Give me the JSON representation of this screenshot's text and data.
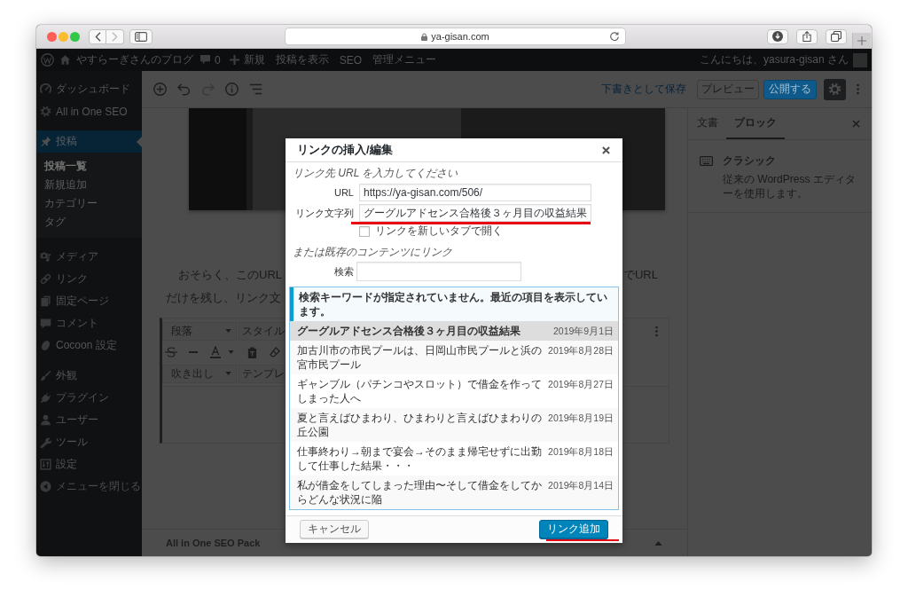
{
  "browser": {
    "back": {
      "disabled": false
    },
    "forward": {
      "disabled": true
    },
    "url": "ya-gisan.com"
  },
  "admin_bar": {
    "site_name": "やすらーぎさんのブログ",
    "comment_count": "0",
    "new_label": "新規",
    "links": [
      "投稿を表示",
      "SEO",
      "管理メニュー"
    ],
    "greeting": "こんにちは、yasura-gisan さん"
  },
  "sidebar": {
    "groups": [
      {
        "items": [
          {
            "label": "ダッシュボード",
            "selected": false
          },
          {
            "label": "All in One SEO",
            "selected": false
          }
        ]
      },
      {
        "items": [
          {
            "label": "投稿",
            "selected": true,
            "children": [
              {
                "label": "投稿一覧",
                "selected": true
              },
              {
                "label": "新規追加",
                "selected": false
              },
              {
                "label": "カテゴリー",
                "selected": false
              },
              {
                "label": "タグ",
                "selected": false
              }
            ]
          }
        ]
      },
      {
        "items": [
          {
            "label": "メディア",
            "selected": false
          },
          {
            "label": "リンク",
            "selected": false
          },
          {
            "label": "固定ページ",
            "selected": false
          },
          {
            "label": "コメント",
            "selected": false
          },
          {
            "label": "Cocoon 設定",
            "selected": false
          }
        ]
      },
      {
        "items": [
          {
            "label": "外観",
            "selected": false
          },
          {
            "label": "プラグイン",
            "selected": false
          },
          {
            "label": "ユーザー",
            "selected": false
          },
          {
            "label": "ツール",
            "selected": false
          },
          {
            "label": "設定",
            "selected": false
          }
        ]
      }
    ],
    "collapse_label": "メニューを閉じる"
  },
  "editor_header": {
    "tools": [
      {
        "disabled": false
      },
      {
        "disabled": false
      },
      {
        "disabled": true
      },
      {
        "disabled": false
      },
      {
        "disabled": false
      }
    ],
    "save_draft": "下書きとして保存",
    "preview": "プレビュー",
    "publish": "公開する",
    "settings_button": {
      "pressed": true
    }
  },
  "editor": {
    "paragraph": {
      "lines": [
        {
          "left": "おそらく、このURL",
          "right": "でURL"
        },
        {
          "left": "だけを残し、リンク文"
        }
      ]
    },
    "classic_toolbar": {
      "format": "段落",
      "style": "スタイル",
      "balloon": "吹き出し",
      "template": "テンプレ"
    },
    "metabox": {
      "title": "All in One SEO Pack"
    }
  },
  "settings_panel": {
    "tabs": [
      {
        "label": "文書",
        "selected": false
      },
      {
        "label": "ブロック",
        "selected": true
      }
    ],
    "block": {
      "name": "クラシック",
      "description": "従来の WordPress エディターを使用します。"
    }
  },
  "dialog": {
    "title": "リンクの挿入/編集",
    "url_heading": "リンク先 URL を入力してください",
    "fields": [
      {
        "label": "URL",
        "value": "https://ya-gisan.com/506/",
        "marked": false
      },
      {
        "label": "リンク文字列",
        "value": "グーグルアドセンス合格後３ヶ月目の収益結果",
        "marked": true
      }
    ],
    "new_tab": {
      "label": "リンクを新しいタブで開く",
      "checked": false
    },
    "existing_heading": "または既存のコンテンツにリンク",
    "search": {
      "label": "検索"
    },
    "notice": "検索キーワードが指定されていません。最近の項目を表示しています。",
    "results": [
      {
        "title": "グーグルアドセンス合格後３ヶ月目の収益結果",
        "date": "2019年9月1日",
        "selected": true
      },
      {
        "title": "加古川市の市民プールは、日岡山市民プールと浜の宮市民プール",
        "date": "2019年8月28日",
        "selected": false
      },
      {
        "title": "ギャンブル（パチンコやスロット）で借金を作ってしまった人へ",
        "date": "2019年8月27日",
        "selected": false
      },
      {
        "title": "夏と言えばひまわり、ひまわりと言えばひまわりの丘公園",
        "date": "2019年8月19日",
        "selected": false
      },
      {
        "title": "仕事終わり→朝まで宴会→そのまま帰宅せずに出勤して仕事した結果・・・",
        "date": "2019年8月18日",
        "selected": false
      },
      {
        "title": "私が借金をしてしまった理由〜そして借金をしてからどんな状況に陥",
        "date": "2019年8月14日",
        "selected": false
      }
    ],
    "cancel": "キャンセル",
    "submit": {
      "label": "リンク追加",
      "marked": true
    }
  }
}
